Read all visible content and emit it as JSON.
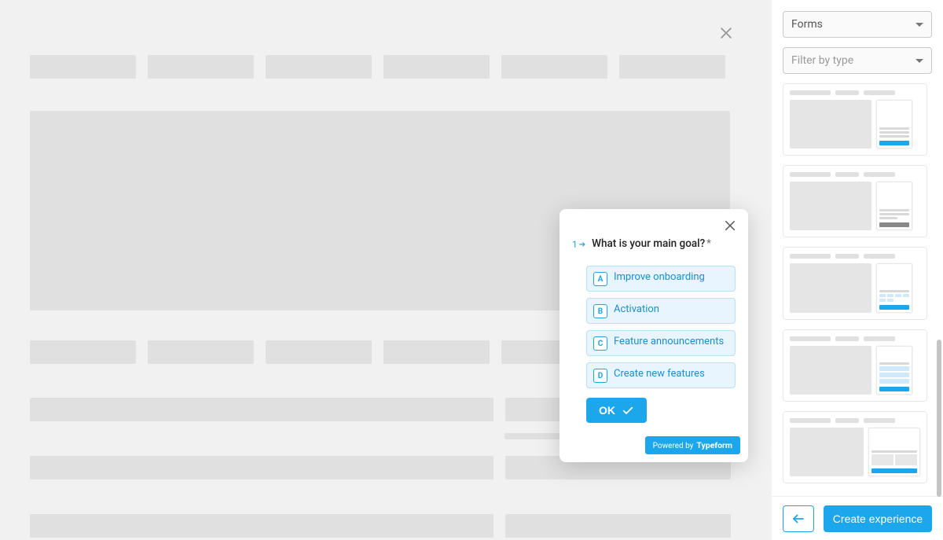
{
  "right_panel": {
    "category_select": "Forms",
    "type_filter_placeholder": "Filter by type",
    "back_aria": "Back",
    "create_button": "Create experience"
  },
  "survey": {
    "question_number": "1",
    "question_text": "What is your main goal?",
    "required_marker": "*",
    "options": [
      {
        "key": "A",
        "label": "Improve onboarding"
      },
      {
        "key": "B",
        "label": "Activation"
      },
      {
        "key": "C",
        "label": "Feature announcements"
      },
      {
        "key": "D",
        "label": "Create new features"
      }
    ],
    "ok_label": "OK",
    "powered_prefix": "Powered by",
    "powered_brand": "Typeform"
  }
}
